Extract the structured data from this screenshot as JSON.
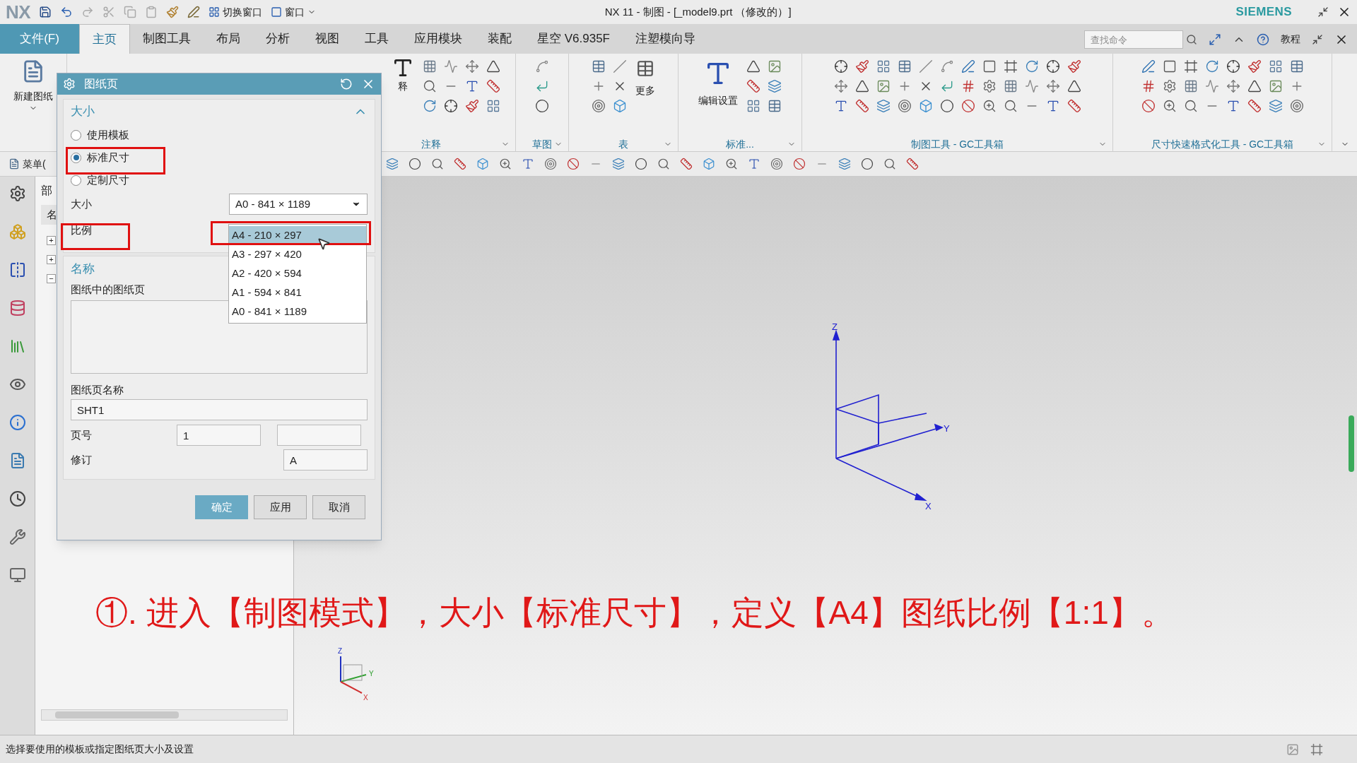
{
  "title_bar": {
    "logo": "NX",
    "quick_access": [
      "切换窗口",
      "窗口"
    ],
    "title": "NX 11 - 制图 - [_model9.prt （修改的）]",
    "brand": "SIEMENS"
  },
  "menu_tabs": [
    {
      "label": "文件(F)",
      "kind": "file",
      "selected": false
    },
    {
      "label": "主页",
      "kind": "tab",
      "selected": true
    },
    {
      "label": "制图工具",
      "kind": "tab",
      "selected": false
    },
    {
      "label": "布局",
      "kind": "tab",
      "selected": false
    },
    {
      "label": "分析",
      "kind": "tab",
      "selected": false
    },
    {
      "label": "视图",
      "kind": "tab",
      "selected": false
    },
    {
      "label": "工具",
      "kind": "tab",
      "selected": false
    },
    {
      "label": "应用模块",
      "kind": "tab",
      "selected": false
    },
    {
      "label": "装配",
      "kind": "tab",
      "selected": false
    },
    {
      "label": "星空 V6.935F",
      "kind": "tab",
      "selected": false
    },
    {
      "label": "注塑模向导",
      "kind": "tab",
      "selected": false
    }
  ],
  "search": {
    "placeholder": "查找命令"
  },
  "help_label": "教程",
  "ribbon": {
    "new_sheet": "新建图纸",
    "annotation_cut": "释",
    "groups": [
      {
        "label": "注释"
      },
      {
        "label": "草图"
      },
      {
        "label": "表",
        "button": "更多"
      },
      {
        "label": "标准...",
        "button": "编辑设置"
      },
      {
        "label": "制图工具 - GC工具箱"
      },
      {
        "label": "尺寸快速格式化工具 - GC工具箱"
      }
    ]
  },
  "toolbar": {
    "menu": "菜单("
  },
  "navigator": {
    "tab": "部",
    "column": "名",
    "nodes": [
      {
        "expander": "+"
      },
      {
        "expander": "+"
      },
      {
        "expander": "−"
      }
    ]
  },
  "dialog": {
    "title": "图纸页",
    "size_section": "大小",
    "options": [
      {
        "label": "使用模板",
        "selected": false
      },
      {
        "label": "标准尺寸",
        "selected": true
      },
      {
        "label": "定制尺寸",
        "selected": false
      }
    ],
    "size_label": "大小",
    "size_value": "A0 - 841 × 1189",
    "size_list": [
      {
        "label": "A4 - 210 × 297",
        "selected": true
      },
      {
        "label": "A3 - 297 × 420",
        "selected": false
      },
      {
        "label": "A2 - 420 × 594",
        "selected": false
      },
      {
        "label": "A1 - 594 × 841",
        "selected": false
      },
      {
        "label": "A0 - 841 × 1189",
        "selected": false
      }
    ],
    "scale_label": "比例",
    "name_section": "名称",
    "sheets_label": "图纸中的图纸页",
    "sheet_name_label": "图纸页名称",
    "sheet_name": "SHT1",
    "page_label": "页号",
    "page_number": "1",
    "revision_label": "修订",
    "revision": "A",
    "buttons": [
      {
        "label": "确定",
        "primary": true
      },
      {
        "label": "应用",
        "primary": false
      },
      {
        "label": "取消",
        "primary": false
      }
    ]
  },
  "canvas": {
    "triad_labels": [
      "Z",
      "Y",
      "X"
    ],
    "mini_triad_labels": [
      "Z",
      "Y",
      "X"
    ]
  },
  "caption": "①. 进入【制图模式】，大小【标准尺寸】，定义【A4】图纸比例【1:1】。",
  "status_bar": "选择要使用的模板或指定图纸页大小及设置"
}
